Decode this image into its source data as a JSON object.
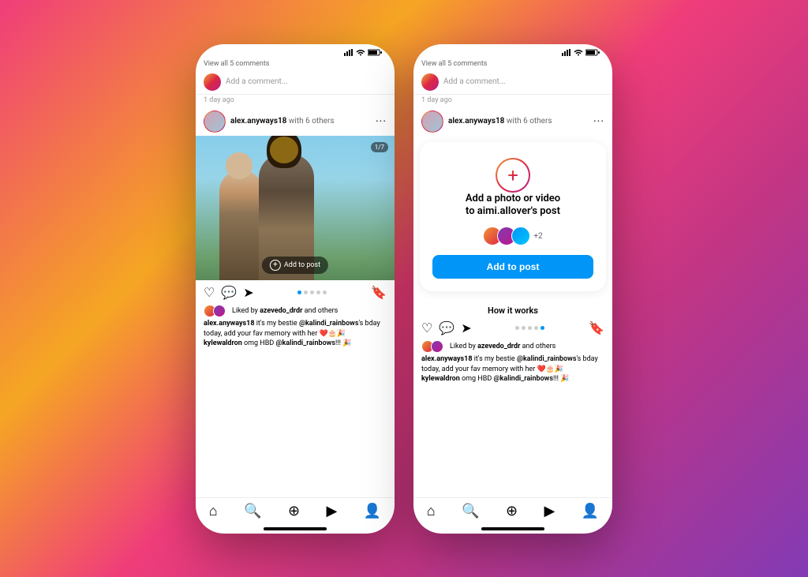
{
  "background": {
    "gradient": "linear-gradient(135deg, #f03d7a, #f5a623, #c13584, #833ab4)"
  },
  "phones": [
    {
      "id": "left-phone",
      "statusBar": {
        "time": "",
        "signal": "▪▪▪",
        "wifi": "wifi",
        "battery": "battery"
      },
      "viewAllComments": "View all 5 comments",
      "commentPlaceholder": "Add a comment...",
      "timeAgo": "1 day ago",
      "postHeader": {
        "username": "alex.anyways18",
        "with": "with 6 others"
      },
      "photoBadge": "1/7",
      "addToPost": "Add to post",
      "pagination": {
        "dots": 5,
        "active": 0
      },
      "likes": {
        "likedBy": "azevedo_drdr",
        "text": "Liked by azevedo_drdr and others"
      },
      "caption": "alex.anyways18 it's my bestie @kalindi_rainbows's bday today, add your fav memory with her ❤️🎂🎉",
      "captionComment": "kylewaldron omg HBD @kalindi_rainbows!!! 🎉"
    },
    {
      "id": "right-phone",
      "statusBar": {
        "time": "",
        "signal": "▪▪▪",
        "wifi": "wifi",
        "battery": "battery"
      },
      "viewAllComments": "View all 5 comments",
      "commentPlaceholder": "Add a comment...",
      "timeAgo": "1 day ago",
      "postHeader": {
        "username": "alex.anyways18",
        "with": "with 6 others"
      },
      "overlayCard": {
        "plusSymbol": "+",
        "title": "Add a photo or video\nto aimi.allover's post",
        "avatarCount": "+2",
        "addToPostButton": "Add to post",
        "howItWorks": "How it works"
      },
      "pagination": {
        "dots": 5,
        "active": 4
      },
      "likes": {
        "text": "Liked by azevedo_drdr and others"
      },
      "caption": "alex.anyways18 it's my bestie @kalindi_rainbows's bday today, add your fav memory with her ❤️🎂🎉",
      "captionComment": "kylewaldron omg HBD @kalindi_rainbows!!! 🎉"
    }
  ]
}
